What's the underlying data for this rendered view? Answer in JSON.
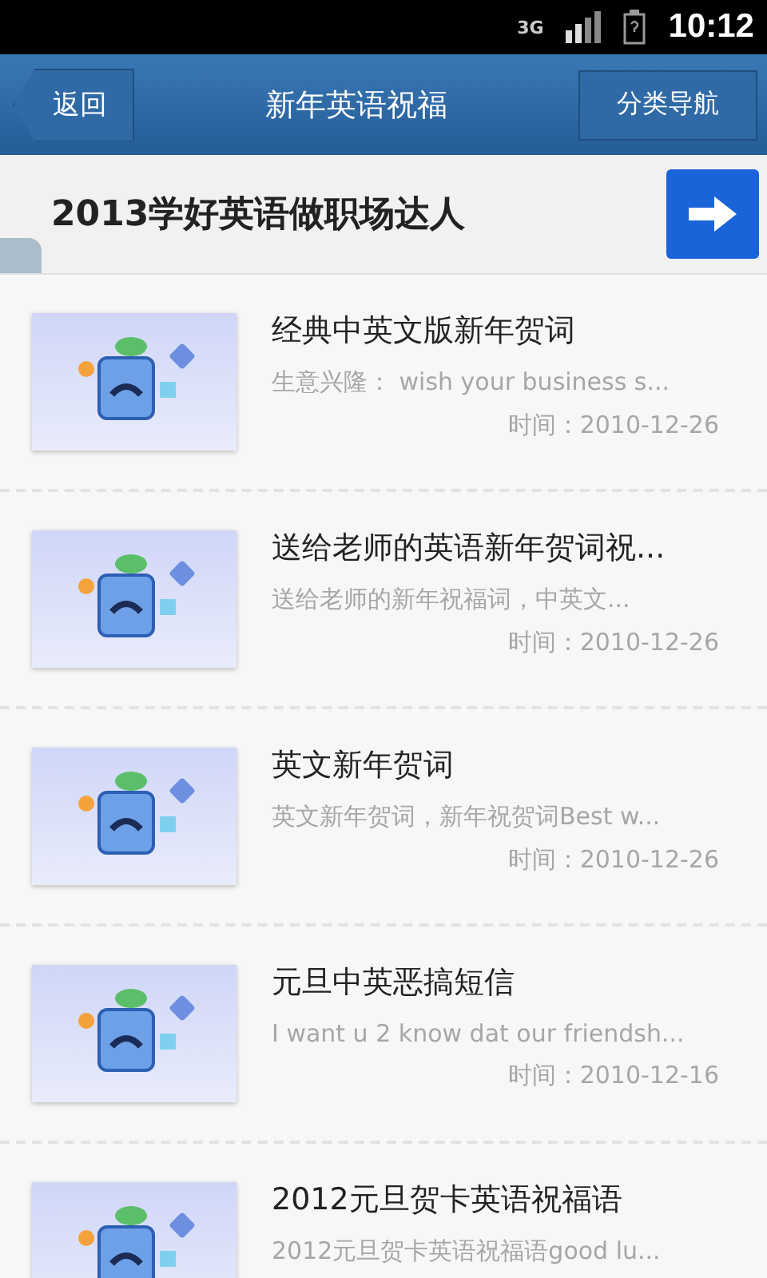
{
  "status_bar": {
    "network": "3G",
    "time": "10:12"
  },
  "nav": {
    "back": "返回",
    "title": "新年英语祝福",
    "menu": "分类导航"
  },
  "banner": {
    "text": "2013学好英语做职场达人"
  },
  "items": [
    {
      "title": "经典中英文版新年贺词",
      "summary": "生意兴隆： wish your business s...",
      "time": "时间：2010-12-26"
    },
    {
      "title": "送给老师的英语新年贺词祝...",
      "summary": "送给老师的新年祝福词，中英文...",
      "time": "时间：2010-12-26"
    },
    {
      "title": "英文新年贺词",
      "summary": "英文新年贺词，新年祝贺词Best w...",
      "time": "时间：2010-12-26"
    },
    {
      "title": "元旦中英恶搞短信",
      "summary": "I want u 2 know dat our friendsh...",
      "time": "时间：2010-12-16"
    },
    {
      "title": "2012元旦贺卡英语祝福语",
      "summary": "2012元旦贺卡英语祝福语good lu..."
    }
  ]
}
